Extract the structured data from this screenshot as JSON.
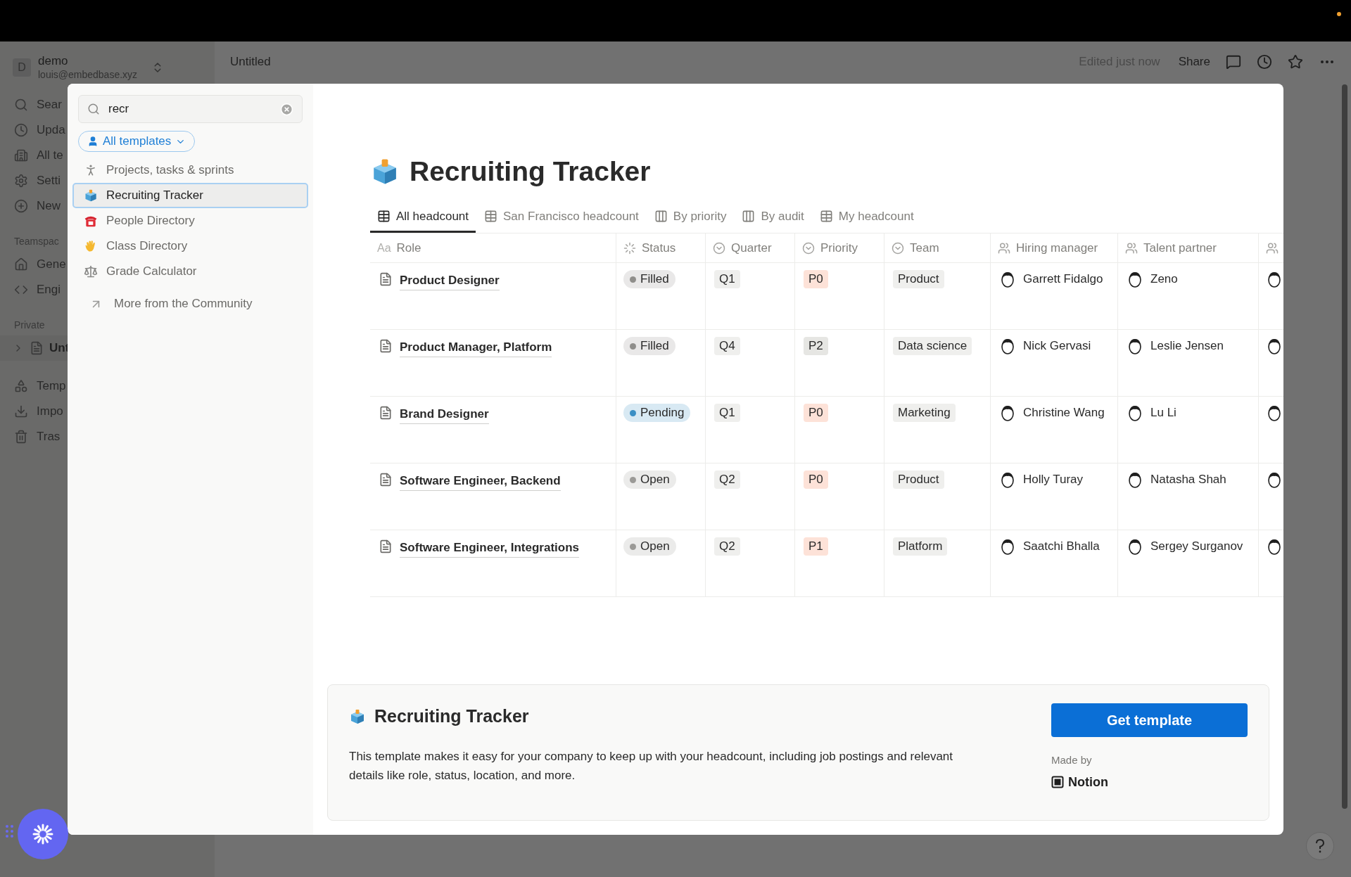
{
  "background": {
    "workspace": {
      "initial": "D",
      "name": "demo",
      "email": "louis@embedbase.xyz"
    },
    "nav": [
      {
        "label": "Sear"
      },
      {
        "label": "Upda"
      },
      {
        "label": "All te"
      },
      {
        "label": "Setti"
      },
      {
        "label": "New"
      }
    ],
    "teamspaces": {
      "heading": "Teamspac",
      "items": [
        {
          "label": "Gene"
        },
        {
          "label": "Engi"
        }
      ]
    },
    "private": {
      "heading": "Private",
      "items": [
        {
          "label": "Unt",
          "expanded": false
        }
      ]
    },
    "bottom": [
      {
        "label": "Temp"
      },
      {
        "label": "Impo"
      },
      {
        "label": "Tras"
      }
    ],
    "page_title": "Untitled",
    "edited": "Edited just now",
    "share": "Share"
  },
  "modal": {
    "search": {
      "value": "recr"
    },
    "filter": "All templates",
    "results": [
      {
        "label": "Projects, tasks & sprints",
        "selected": false
      },
      {
        "label": "Recruiting Tracker",
        "selected": true
      },
      {
        "label": "People Directory",
        "selected": false
      },
      {
        "label": "Class Directory",
        "selected": false
      },
      {
        "label": "Grade Calculator",
        "selected": false
      }
    ],
    "more": "More from the Community",
    "preview": {
      "title": "Recruiting Tracker",
      "tabs": [
        {
          "kind": "table",
          "label": "All headcount",
          "selected": true
        },
        {
          "kind": "table",
          "label": "San Francisco headcount",
          "selected": false
        },
        {
          "kind": "board",
          "label": "By priority",
          "selected": false
        },
        {
          "kind": "board",
          "label": "By audit",
          "selected": false
        },
        {
          "kind": "table",
          "label": "My headcount",
          "selected": false
        }
      ],
      "columns": [
        {
          "kind": "text",
          "type_label": "Aa",
          "label": "Role"
        },
        {
          "kind": "status",
          "label": "Status"
        },
        {
          "kind": "select",
          "label": "Quarter"
        },
        {
          "kind": "select",
          "label": "Priority"
        },
        {
          "kind": "select",
          "label": "Team"
        },
        {
          "kind": "person",
          "label": "Hiring manager"
        },
        {
          "kind": "person",
          "label": "Talent partner"
        },
        {
          "kind": "person"
        }
      ],
      "rows": [
        {
          "role": "Product Designer",
          "status": {
            "label": "Filled",
            "color": "#8f8e8b"
          },
          "quarter": "Q1",
          "priority": {
            "label": "P0",
            "color": "#fde2d8"
          },
          "team": "Product",
          "hiring_manager": "Garrett Fidalgo",
          "talent_partner": "Zeno"
        },
        {
          "role": "Product Manager, Platform",
          "status": {
            "label": "Filled",
            "color": "#8f8e8b"
          },
          "quarter": "Q4",
          "priority": {
            "label": "P2",
            "color": "#e6e6e3"
          },
          "team": "Data science",
          "hiring_manager": "Nick Gervasi",
          "talent_partner": "Leslie Jensen"
        },
        {
          "role": "Brand Designer",
          "status": {
            "label": "Pending",
            "color": "#3b8fc4"
          },
          "quarter": "Q1",
          "priority": {
            "label": "P0",
            "color": "#fde2d8"
          },
          "team": "Marketing",
          "hiring_manager": "Christine Wang",
          "talent_partner": "Lu Li"
        },
        {
          "role": "Software Engineer, Backend",
          "status": {
            "label": "Open",
            "color": "#9b9a97"
          },
          "quarter": "Q2",
          "priority": {
            "label": "P0",
            "color": "#fde2d8"
          },
          "team": "Product",
          "hiring_manager": "Holly Turay",
          "talent_partner": "Natasha Shah"
        },
        {
          "role": "Software Engineer, Integrations",
          "status": {
            "label": "Open",
            "color": "#9b9a97"
          },
          "quarter": "Q2",
          "priority": {
            "label": "P1",
            "color": "#fde2d8"
          },
          "team": "Platform",
          "hiring_manager": "Saatchi Bhalla",
          "talent_partner": "Sergey Surganov"
        }
      ]
    },
    "card": {
      "title": "Recruiting Tracker",
      "description": "This template makes it easy for your company to keep up with your headcount, including job postings and relevant details like role, status, location, and more.",
      "button": "Get template",
      "made_by_label": "Made by",
      "author": "Notion"
    }
  }
}
